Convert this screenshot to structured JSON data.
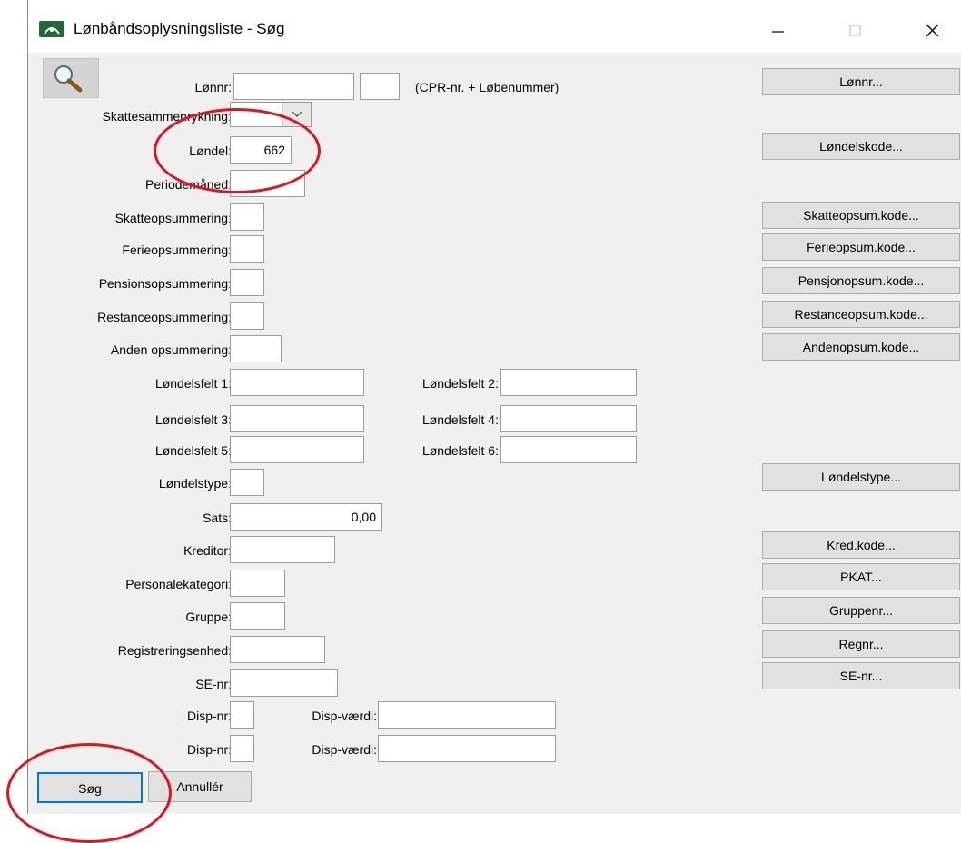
{
  "window": {
    "title": "Lønbåndsoplysningsliste - Søg",
    "colors": {
      "accent": "#1f6b33",
      "annotation": "#e0141c"
    }
  },
  "icons": {
    "app": "app-logo-icon",
    "search": "magnifier-icon",
    "minimize": "minimize-icon",
    "maximize": "maximize-icon",
    "close": "close-icon",
    "dropdown": "chevron-down-icon"
  },
  "form": {
    "lonnr_label": "Lønnr:",
    "lonnr_hint": "(CPR-nr. + Løbenummer)",
    "skattesammenrykning_label": "Skattesammenrykning:",
    "londel_label": "Løndel:",
    "londel_value": "662",
    "periodemaaned_label": "Periodemåned:",
    "skatteopsummering_label": "Skatteopsummering:",
    "ferieopsummering_label": "Ferieopsummering:",
    "pensionsopsummering_label": "Pensionsopsummering:",
    "restanceopsummering_label": "Restanceopsummering:",
    "anden_opsummering_label": "Anden opsummering:",
    "londelsfelt1_label": "Løndelsfelt 1:",
    "londelsfelt2_label": "Løndelsfelt 2:",
    "londelsfelt3_label": "Løndelsfelt 3:",
    "londelsfelt4_label": "Løndelsfelt 4:",
    "londelsfelt5_label": "Løndelsfelt 5:",
    "londelsfelt6_label": "Løndelsfelt 6:",
    "londelstype_label": "Løndelstype:",
    "sats_label": "Sats:",
    "sats_value": "0,00",
    "kreditor_label": "Kreditor:",
    "personalekategori_label": "Personalekategori:",
    "gruppe_label": "Gruppe:",
    "registreringsenhed_label": "Registreringsenhed:",
    "se_nr_label": "SE-nr:",
    "disp_nr_label": "Disp-nr:",
    "disp_vaerdi_label": "Disp-værdi:"
  },
  "buttons": {
    "lonnr": "Lønnr...",
    "londelskode": "Løndelskode...",
    "skatteopsum": "Skatteopsum.kode...",
    "ferieopsum": "Ferieopsum.kode...",
    "pensionopsum": "Pensjonopsum.kode...",
    "restanceopsum": "Restanceopsum.kode...",
    "andenopsum": "Andenopsum.kode...",
    "londelstype": "Løndelstype...",
    "kredkode": "Kred.kode...",
    "pkat": "PKAT...",
    "gruppenr": "Gruppenr...",
    "regnr": "Regnr...",
    "se_nr": "SE-nr...",
    "sog": "Søg",
    "annuller": "Annullér"
  }
}
